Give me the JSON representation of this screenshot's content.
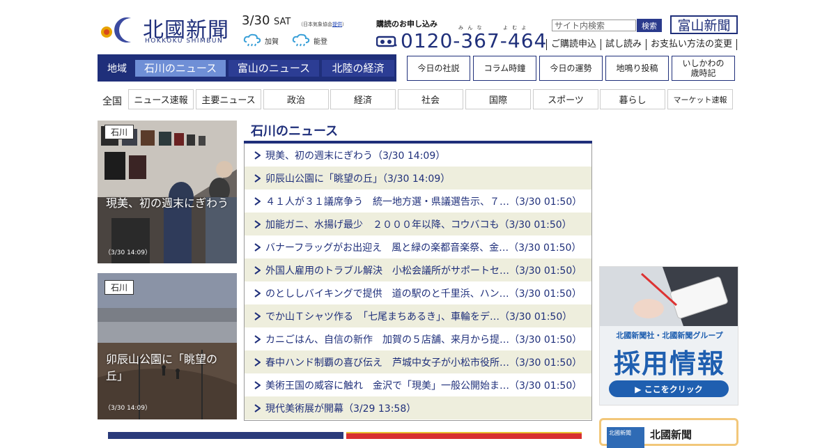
{
  "header": {
    "logo_jp": "北國新聞",
    "logo_en": "HOKKOKU SHIMBUN",
    "date": "3/30",
    "day_of_week": "SAT",
    "weather_credit_prefix": "（日本気象協会",
    "weather_credit_link": "提供",
    "weather_credit_suffix": "）",
    "weather": [
      {
        "region": "加賀",
        "icon": "cloud-rain-icon"
      },
      {
        "region": "能登",
        "icon": "cloud-rain-icon"
      }
    ]
  },
  "subscribe": {
    "title": "購読のお申し込み",
    "ruby_1": "み ん な",
    "ruby_2": "よ む よ",
    "phone": "0120-367-464"
  },
  "search": {
    "placeholder": "サイト内検索",
    "button_label": "検索"
  },
  "toyama_logo": "富山新聞",
  "sub_links": [
    "ご購読申込",
    "試し読み",
    "お支払い方法の変更"
  ],
  "region_nav": {
    "label": "地域",
    "tabs": [
      {
        "label": "石川のニュース",
        "active": true
      },
      {
        "label": "富山のニュース",
        "active": false
      },
      {
        "label": "北陸の経済",
        "active": false
      }
    ]
  },
  "util_buttons": [
    "今日の社説",
    "コラム時鐘",
    "今日の運勢",
    "地鳴り投稿",
    "いしかわの\n歳時記"
  ],
  "categories": {
    "label": "全国",
    "items": [
      "ニュース速報",
      "主要ニュース",
      "政治",
      "経済",
      "社会",
      "国際",
      "スポーツ",
      "暮らし",
      "マーケット速報"
    ]
  },
  "photo_cards": [
    {
      "tag": "石川",
      "title": "現美、初の週末にぎわう",
      "time": "（3/30 14:09）"
    },
    {
      "tag": "石川",
      "title": "卯辰山公園に「眺望の丘」",
      "time": "（3/30 14:09）"
    }
  ],
  "news_list": {
    "heading": "石川のニュース",
    "items": [
      "現美、初の週末にぎわう（3/30 14:09）",
      "卯辰山公園に「眺望の丘」（3/30 14:09）",
      "４１人が３１議席争う　統一地方選・県議選告示、７…（3/30 01:50）",
      "加能ガニ、水揚げ最少　２０００年以降、コウバコも（3/30 01:50）",
      "バナーフラッグがお出迎え　風と緑の楽都音楽祭、金…（3/30 01:50）",
      "外国人雇用のトラブル解決　小松会議所がサポートセ…（3/30 01:50）",
      "のとししバイキングで提供　道の駅のと千里浜、ハン…（3/30 01:50）",
      "でか山Ｔシャツ作る　「七尾まちあるき」、車輪をデ…（3/30 01:50）",
      "カニごはん、自信の新作　加賀の５店舗、来月から提…（3/30 01:50）",
      "春中ハンド制覇の喜び伝え　芦城中女子が小松市役所…（3/30 01:50）",
      "美術王国の威容に触れ　金沢で「現美」一般公開始ま…（3/30 01:50）",
      "現代美術展が開幕（3/29 13:58）"
    ]
  },
  "ad_banner": {
    "subtitle": "北國新聞社・北國新聞グループ",
    "title": "採用情報",
    "cta": "▶ ここをクリック"
  },
  "ad_small": {
    "logo_text": "北國新聞",
    "text": "北國新聞"
  },
  "colors": {
    "brand_navy": "#1f2f7a",
    "active_tab": "#6f8fd6",
    "list_alt_row": "#eeeedd",
    "ad_blue": "#1f5fb0"
  }
}
